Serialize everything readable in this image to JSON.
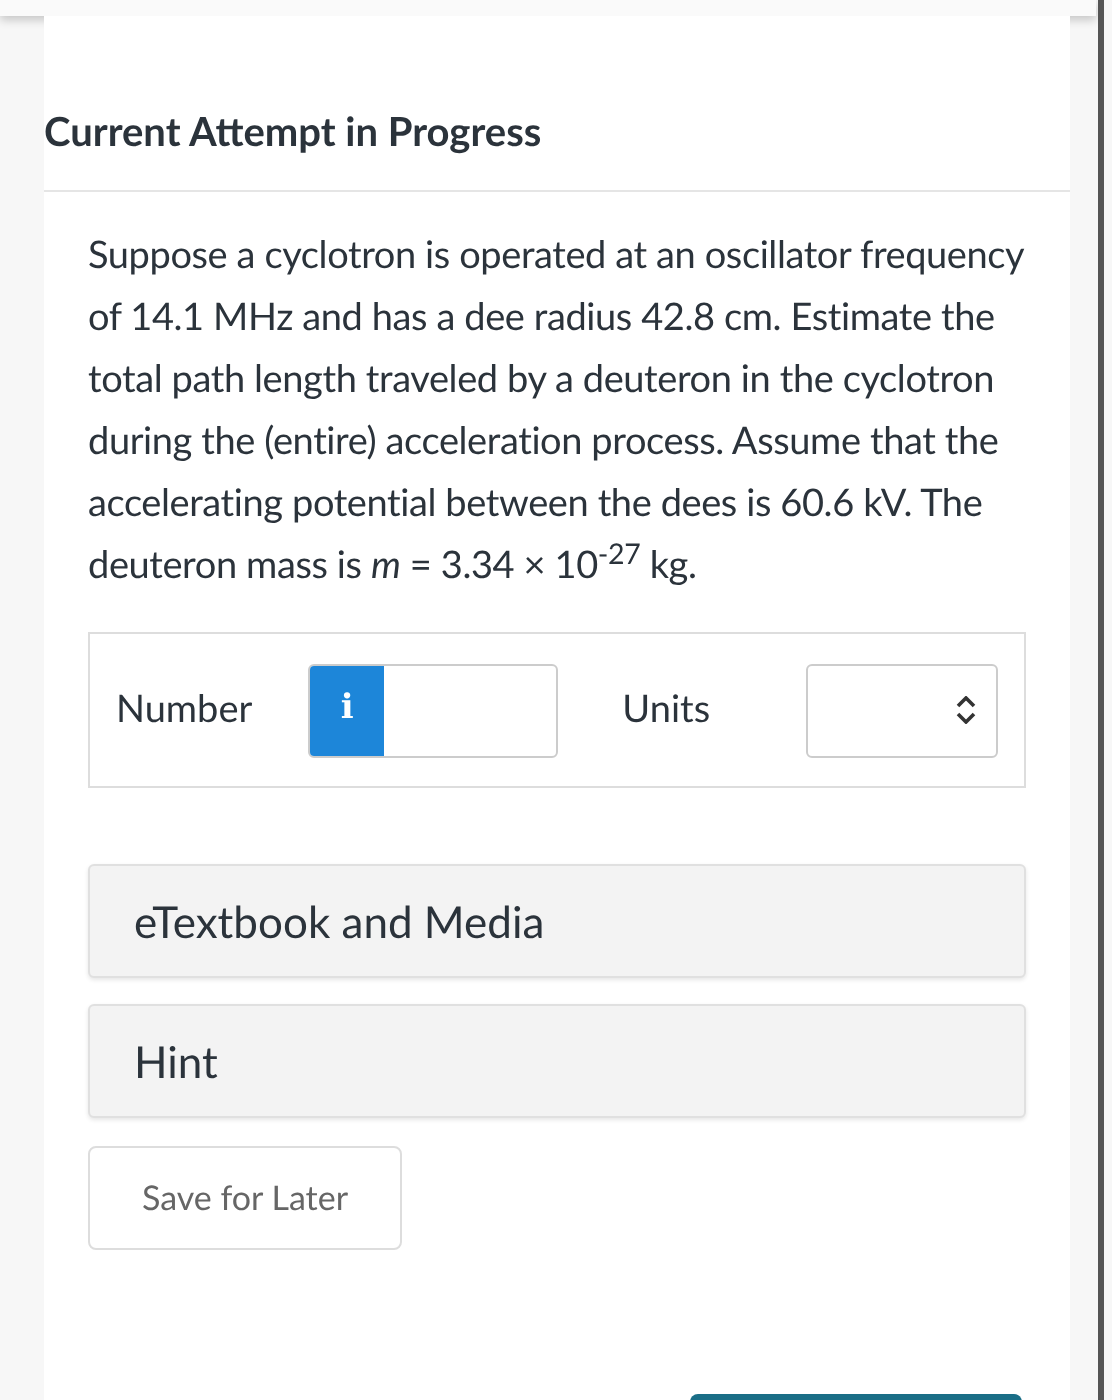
{
  "heading": "Current Attempt in Progress",
  "question": "Suppose a cyclotron is operated at an oscillator frequency of 14.1 MHz and has a dee radius 42.8 cm. Estimate the total path length traveled by a deuteron in the cyclotron during the (entire) acceleration process. Assume that the accelerating potential between the dees is 60.6 kV. The deuteron mass is *m* = 3.34 × 10$^{-27}$ kg.",
  "answer": {
    "number_label": "Number",
    "info_icon": "i",
    "units_label": "Units"
  },
  "resources": [
    {
      "label": "eTextbook and Media"
    },
    {
      "label": "Hint"
    }
  ],
  "save_button": "Save for Later"
}
